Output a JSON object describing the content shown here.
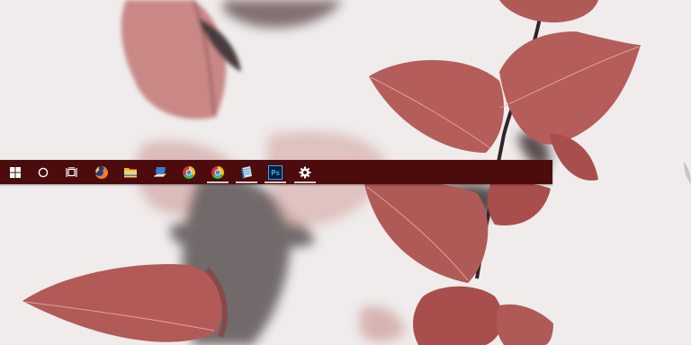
{
  "desktop": {
    "wallpaper": "pink-leaves-wallpaper",
    "colors": {
      "leaf": "#b05a58",
      "leaf_dark": "#8e3c3c",
      "background": "#efeceb",
      "taskbar": "#4c0c0d"
    }
  },
  "taskbar": {
    "items": [
      {
        "name": "start",
        "icon": "windows-logo-icon",
        "running": false
      },
      {
        "name": "search",
        "icon": "cortana-circle-icon",
        "running": false
      },
      {
        "name": "task-view",
        "icon": "task-view-icon",
        "running": false
      },
      {
        "name": "firefox",
        "icon": "firefox-icon",
        "running": false
      },
      {
        "name": "file-explorer",
        "icon": "folder-icon",
        "running": false
      },
      {
        "name": "app-laptop",
        "icon": "laptop-icon",
        "running": false
      },
      {
        "name": "chrome",
        "icon": "chrome-icon",
        "running": false
      },
      {
        "name": "chrome-canary",
        "icon": "chrome-icon",
        "running": true
      },
      {
        "name": "app-notepad",
        "icon": "notepad-icon",
        "running": true
      },
      {
        "name": "photoshop",
        "icon": "photoshop-icon",
        "label": "Ps",
        "running": true
      },
      {
        "name": "settings",
        "icon": "gear-icon",
        "running": true
      }
    ]
  }
}
